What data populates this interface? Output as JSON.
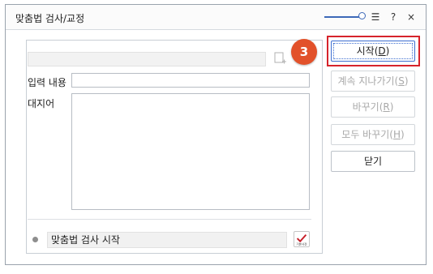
{
  "window": {
    "title": "맞춤법 검사/교정"
  },
  "titlebar_icons": {
    "list": "☰",
    "help": "?",
    "close": "×"
  },
  "form": {
    "input_label": "입력 내용",
    "input_value": "",
    "suggestion_label": "대지어",
    "status_text": "맞춤법 검사 시작",
    "check_icon_text": "기본사전"
  },
  "buttons": {
    "start": {
      "label": "시작",
      "key": "D"
    },
    "skip": {
      "label": "계속 지나가기",
      "key": "S"
    },
    "replace": {
      "label": "바꾸기",
      "key": "R"
    },
    "replace_all": {
      "label": "모두 바꾸기",
      "key": "H"
    },
    "close": {
      "label": "닫기"
    }
  },
  "annotation": {
    "step": "3"
  },
  "colors": {
    "highlight": "#d6232b",
    "badge": "#e2512a",
    "accent": "#3d69b8"
  }
}
